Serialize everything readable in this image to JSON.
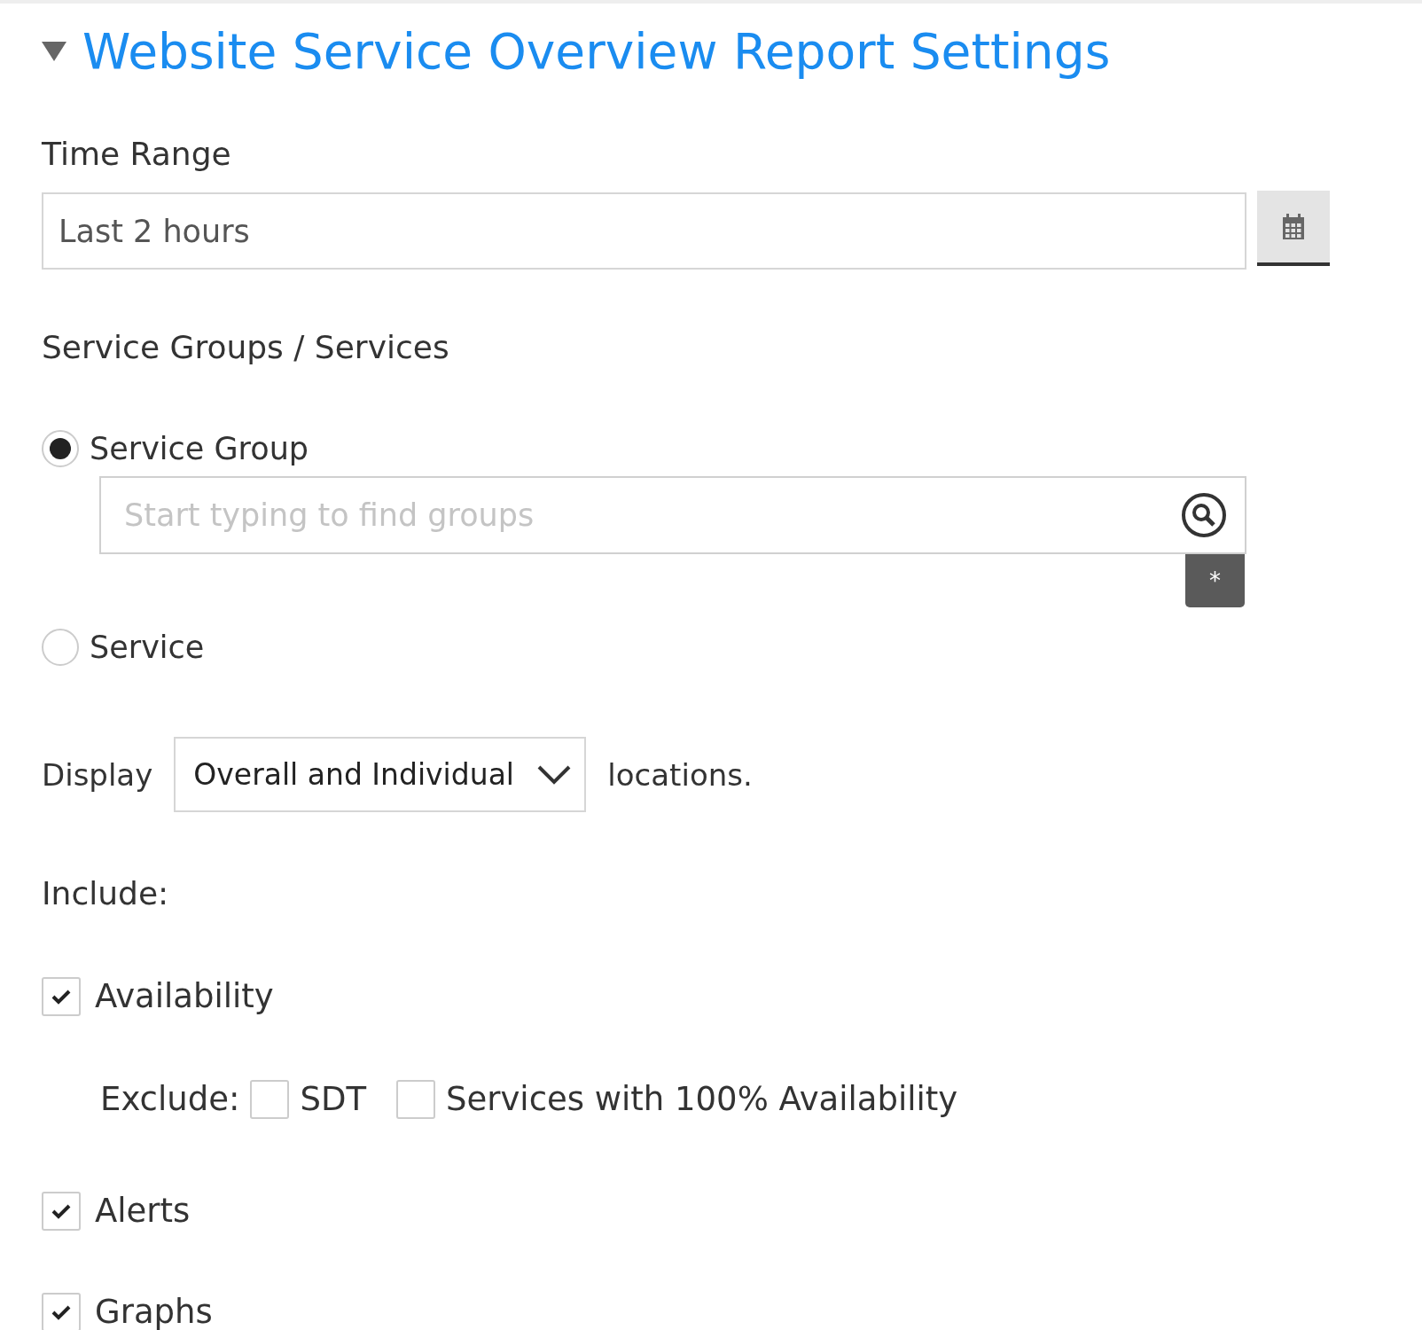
{
  "section": {
    "title": "Website Service Overview Report Settings",
    "expanded": true
  },
  "time_range": {
    "label": "Time Range",
    "value": "Last 2 hours"
  },
  "services": {
    "label": "Service Groups / Services",
    "options": [
      {
        "label": "Service Group",
        "selected": true,
        "placeholder": "Start typing to find groups",
        "tag": "*"
      },
      {
        "label": "Service",
        "selected": false
      }
    ]
  },
  "display": {
    "label": "Display",
    "value": "Overall and Individual",
    "suffix": "locations."
  },
  "include": {
    "label": "Include:",
    "items": [
      {
        "label": "Availability",
        "checked": true,
        "exclude": {
          "label": "Exclude:",
          "options": [
            {
              "label": "SDT",
              "checked": false
            },
            {
              "label": "Services with 100% Availability",
              "checked": false
            }
          ]
        }
      },
      {
        "label": "Alerts",
        "checked": true
      },
      {
        "label": "Graphs",
        "checked": true
      }
    ]
  }
}
